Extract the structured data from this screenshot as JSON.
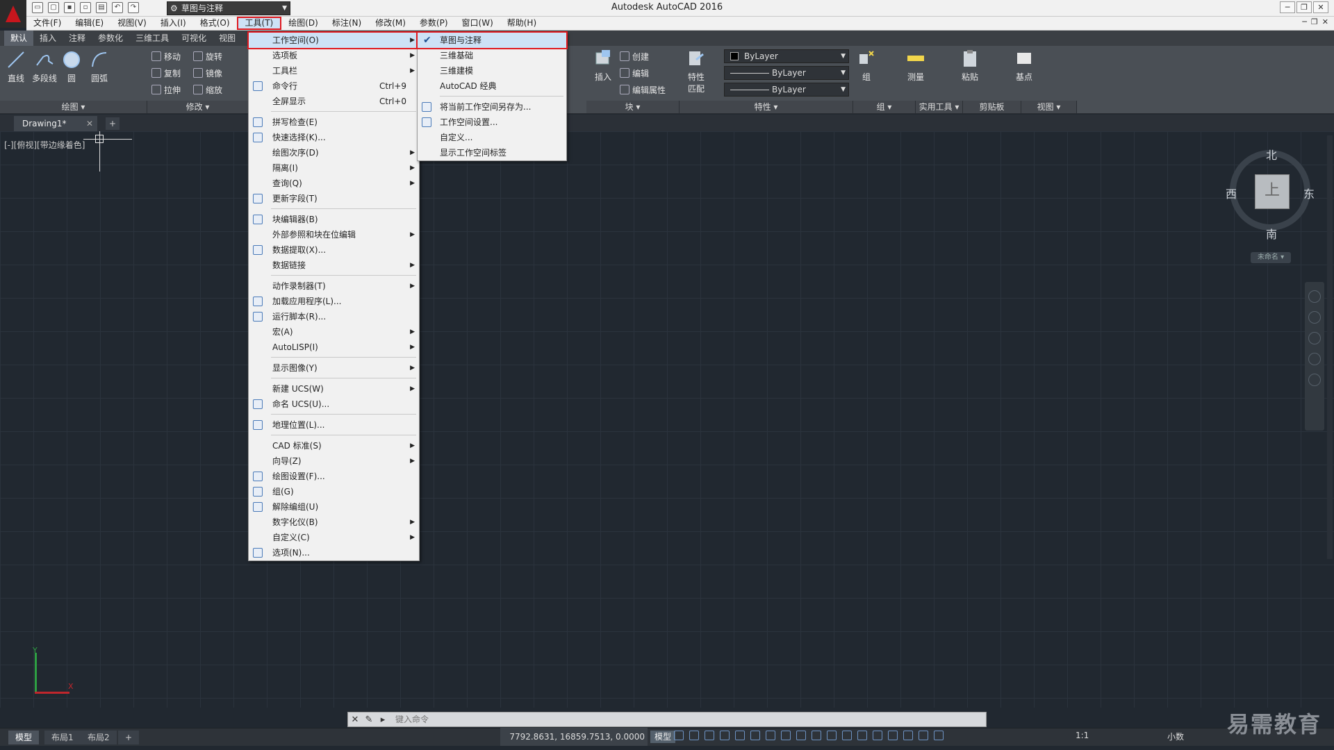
{
  "app": {
    "title": "Autodesk AutoCAD 2016",
    "workspace": "草图与注释"
  },
  "menubar": [
    {
      "label": "文件(F)"
    },
    {
      "label": "编辑(E)"
    },
    {
      "label": "视图(V)"
    },
    {
      "label": "插入(I)"
    },
    {
      "label": "格式(O)"
    },
    {
      "label": "工具(T)"
    },
    {
      "label": "绘图(D)"
    },
    {
      "label": "标注(N)"
    },
    {
      "label": "修改(M)"
    },
    {
      "label": "参数(P)"
    },
    {
      "label": "窗口(W)"
    },
    {
      "label": "帮助(H)"
    }
  ],
  "ribbon_tabs": [
    "默认",
    "插入",
    "注释",
    "参数化",
    "三维工具",
    "可视化",
    "视图"
  ],
  "ribbon": {
    "draw": {
      "line": "直线",
      "polyline": "多段线",
      "circle": "圆",
      "arc": "圆弧",
      "footer": "绘图"
    },
    "modify": {
      "move": "移动",
      "rotate": "旋转",
      "copy": "复制",
      "mirror": "镜像",
      "stretch": "拉伸",
      "scale": "缩放",
      "footer": "修改"
    },
    "block": {
      "insert": "插入",
      "create": "创建",
      "edit": "编辑",
      "edit_attr": "编辑属性",
      "footer": "块"
    },
    "properties": {
      "match": "特性",
      "match2": "匹配",
      "color": "ByLayer",
      "linetype": "ByLayer",
      "lineweight": "ByLayer",
      "footer": "特性"
    },
    "groups": {
      "group": "组",
      "footer": "组"
    },
    "utilities": {
      "measure": "测量",
      "footer": "实用工具"
    },
    "clipboard": {
      "paste": "粘贴",
      "footer": "剪贴板"
    },
    "view": {
      "base": "基点",
      "footer": "视图"
    }
  },
  "file_tab": {
    "name": "Drawing1*"
  },
  "viewport": {
    "label": "[-][俯视][带边缘着色]"
  },
  "viewcube": {
    "north": "北",
    "south": "南",
    "east": "东",
    "west": "西",
    "top": "上",
    "wcs": "未命名"
  },
  "ucs": {
    "x": "X",
    "y": "Y"
  },
  "tools_menu": [
    {
      "label": "工作空间(O)",
      "sub": true,
      "highlight": true
    },
    {
      "label": "选项板",
      "sub": true
    },
    {
      "label": "工具栏",
      "sub": true
    },
    {
      "label": "命令行",
      "shortcut": "Ctrl+9",
      "icon": true
    },
    {
      "label": "全屏显示",
      "shortcut": "Ctrl+0"
    },
    {
      "sep": true
    },
    {
      "label": "拼写检查(E)",
      "icon": true
    },
    {
      "label": "快速选择(K)...",
      "icon": true
    },
    {
      "label": "绘图次序(D)",
      "sub": true
    },
    {
      "label": "隔离(I)",
      "sub": true
    },
    {
      "label": "查询(Q)",
      "sub": true
    },
    {
      "label": "更新字段(T)",
      "icon": true
    },
    {
      "sep": true
    },
    {
      "label": "块编辑器(B)",
      "icon": true
    },
    {
      "label": "外部参照和块在位编辑",
      "sub": true
    },
    {
      "label": "数据提取(X)...",
      "icon": true
    },
    {
      "label": "数据链接",
      "sub": true
    },
    {
      "sep": true
    },
    {
      "label": "动作录制器(T)",
      "sub": true
    },
    {
      "label": "加载应用程序(L)...",
      "icon": true
    },
    {
      "label": "运行脚本(R)...",
      "icon": true
    },
    {
      "label": "宏(A)",
      "sub": true
    },
    {
      "label": "AutoLISP(I)",
      "sub": true
    },
    {
      "sep": true
    },
    {
      "label": "显示图像(Y)",
      "sub": true
    },
    {
      "sep": true
    },
    {
      "label": "新建 UCS(W)",
      "sub": true
    },
    {
      "label": "命名 UCS(U)...",
      "icon": true
    },
    {
      "sep": true
    },
    {
      "label": "地理位置(L)...",
      "icon": true
    },
    {
      "sep": true
    },
    {
      "label": "CAD 标准(S)",
      "sub": true
    },
    {
      "label": "向导(Z)",
      "sub": true
    },
    {
      "label": "绘图设置(F)...",
      "icon": true
    },
    {
      "label": "组(G)",
      "icon": true
    },
    {
      "label": "解除编组(U)",
      "icon": true
    },
    {
      "label": "数字化仪(B)",
      "sub": true
    },
    {
      "label": "自定义(C)",
      "sub": true
    },
    {
      "label": "选项(N)...",
      "icon": true
    }
  ],
  "workspace_menu": [
    {
      "label": "草图与注释",
      "checked": true,
      "highlight": true
    },
    {
      "label": "三维基础"
    },
    {
      "label": "三维建模"
    },
    {
      "label": "AutoCAD 经典"
    },
    {
      "sep": true
    },
    {
      "label": "将当前工作空间另存为...",
      "icon": true
    },
    {
      "label": "工作空间设置...",
      "icon": true
    },
    {
      "label": "自定义..."
    },
    {
      "label": "显示工作空间标签"
    }
  ],
  "cmdline": {
    "placeholder": "键入命令"
  },
  "layout_tabs": [
    "模型",
    "布局1",
    "布局2"
  ],
  "status": {
    "coords": "7792.8631, 16859.7513, 0.0000",
    "model": "模型",
    "scale": "1:1",
    "units": "小数"
  },
  "watermark": "易需教育"
}
